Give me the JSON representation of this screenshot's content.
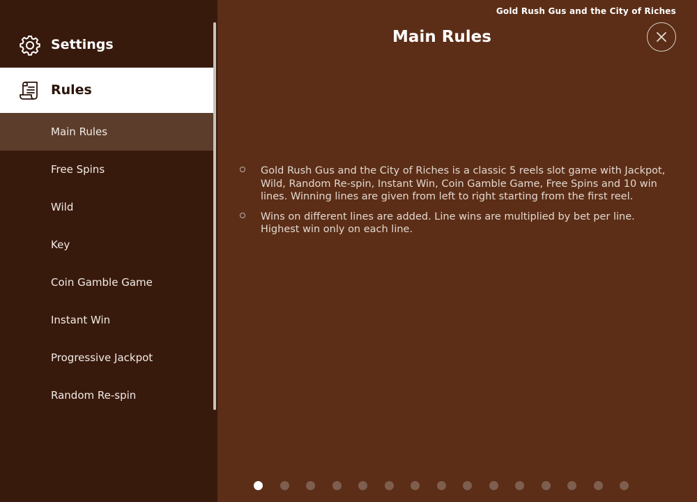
{
  "header": {
    "game_title": "Gold Rush Gus and the City of Riches"
  },
  "sidebar": {
    "settings": {
      "label": "Settings",
      "icon": "gear-icon"
    },
    "rules": {
      "label": "Rules",
      "icon": "scroll-icon"
    },
    "items": [
      {
        "label": "Main Rules",
        "active": true
      },
      {
        "label": "Free Spins"
      },
      {
        "label": "Wild"
      },
      {
        "label": "Key"
      },
      {
        "label": "Coin Gamble Game"
      },
      {
        "label": "Instant Win"
      },
      {
        "label": "Progressive Jackpot"
      },
      {
        "label": "Random Re-spin"
      }
    ]
  },
  "main": {
    "title": "Main Rules",
    "rules": [
      "Gold Rush Gus and the City of Riches is a classic 5 reels slot game with Jackpot, Wild, Random Re-spin, Instant Win, Coin Gamble Game, Free Spins and 10 win lines. Winning lines are given from left to right starting from the first reel.",
      "Wins on different lines are added. Line wins are multiplied by bet per line. Highest win only on each line."
    ],
    "pager": {
      "total": 15,
      "current": 1
    }
  },
  "colors": {
    "sidebar_bg": "#381a0d",
    "main_bg": "#5c2e17",
    "active_item_bg": "#5c3d2c",
    "selected_section_bg": "#ffffff"
  }
}
